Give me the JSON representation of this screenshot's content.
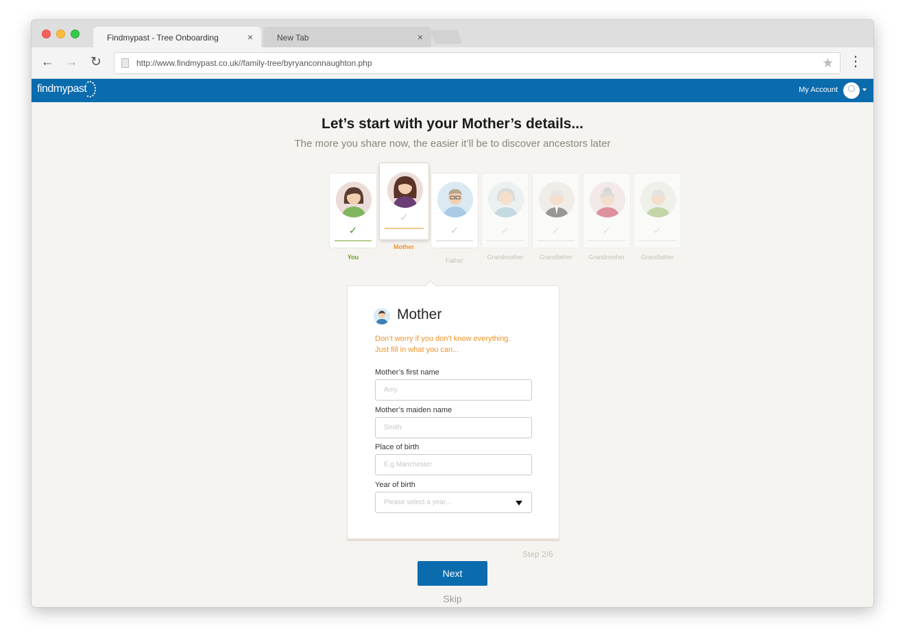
{
  "browser": {
    "tabs": [
      {
        "title": "Findmypast - Tree Onboarding",
        "active": true
      },
      {
        "title": "New Tab",
        "active": false
      }
    ],
    "close_glyph": "×",
    "url": "http://www.findmypast.co.uk//family-tree/byryanconnaughton.php",
    "icons": [
      "back-arrow-icon",
      "forward-arrow-icon",
      "reload-icon",
      "page-icon",
      "bookmark-star-icon",
      "kebab-menu-icon"
    ]
  },
  "site": {
    "logo_text": "findmypast",
    "account_label": "My Account",
    "brand_color": "#0a6bad",
    "accent_color": "#f0912a",
    "success_color": "#4f9a2f"
  },
  "page": {
    "headline": "Let’s start with your Mother’s details...",
    "subheadline": "The more you share now, the easier it’ll be to discover ancestors later"
  },
  "people": [
    {
      "label": "You",
      "state": "done"
    },
    {
      "label": "Mother",
      "state": "current"
    },
    {
      "label": "Father",
      "state": "todo"
    },
    {
      "label": "Grandmother",
      "state": "todo"
    },
    {
      "label": "Grandfather",
      "state": "todo"
    },
    {
      "label": "Grandmother",
      "state": "todo"
    },
    {
      "label": "Grandfather",
      "state": "todo"
    }
  ],
  "form": {
    "title": "Mother",
    "note_line1": "Don’t worry if you don’t know everything.",
    "note_line2": "Just fill in what you can...",
    "fields": [
      {
        "label": "Mother’s first name",
        "placeholder": "Amy"
      },
      {
        "label": "Mother’s maiden name",
        "placeholder": "Smith"
      },
      {
        "label": "Place of birth",
        "placeholder": "E.g Manchester"
      },
      {
        "label": "Year of birth",
        "placeholder": "Please select a year..."
      }
    ]
  },
  "footer": {
    "step": "Step 2/6",
    "next_label": "Next",
    "skip_label": "Skip"
  }
}
